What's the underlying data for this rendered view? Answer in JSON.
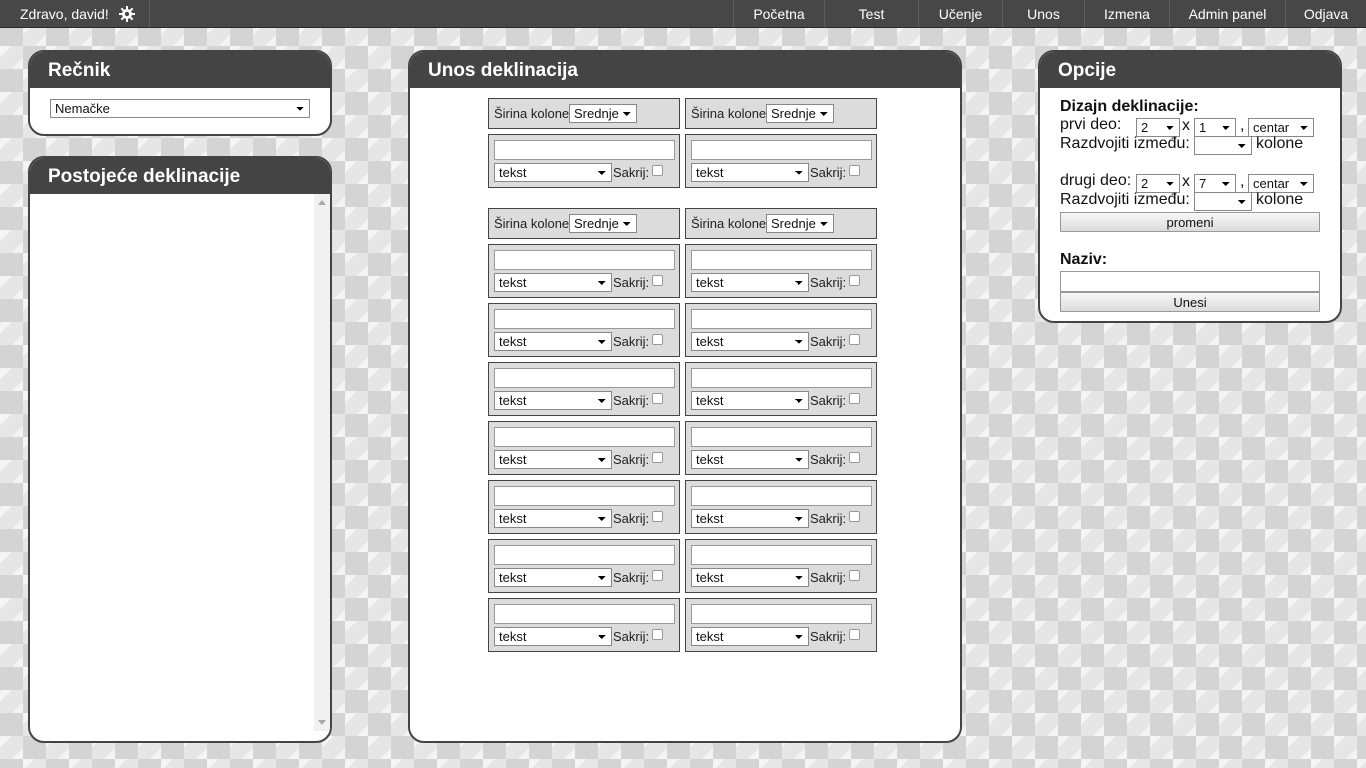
{
  "topbar": {
    "greeting": "Zdravo, david!",
    "gear_icon": "gear-icon",
    "nav": [
      "Početna",
      "Test",
      "Učenje",
      "Unos",
      "Izmena",
      "Admin panel",
      "Odjava"
    ]
  },
  "recnik": {
    "title": "Rečnik",
    "selected": "Nemačke"
  },
  "postojece": {
    "title": "Postojeće deklinacije"
  },
  "unos": {
    "title": "Unos deklinacija",
    "width_label": "Širina kolone:",
    "width_value": "Srednje",
    "type_value": "tekst",
    "hide_label": "Sakrij:"
  },
  "opcije": {
    "title": "Opcije",
    "dizajn_label": "Dizajn deklinacije:",
    "prvi_label": "prvi deo:",
    "prvi_rows": "2",
    "prvi_cols": "1",
    "prvi_align": "centar",
    "x_label": "x",
    "comma": ",",
    "razdvojiti_label": "Razdvojiti između:",
    "kolone_label": "kolone",
    "drugi_label": "drugi deo:",
    "drugi_rows": "2",
    "drugi_cols": "7",
    "drugi_align": "centar",
    "promeni_label": "promeni",
    "naziv_label": "Naziv:",
    "unesi_label": "Unesi"
  }
}
